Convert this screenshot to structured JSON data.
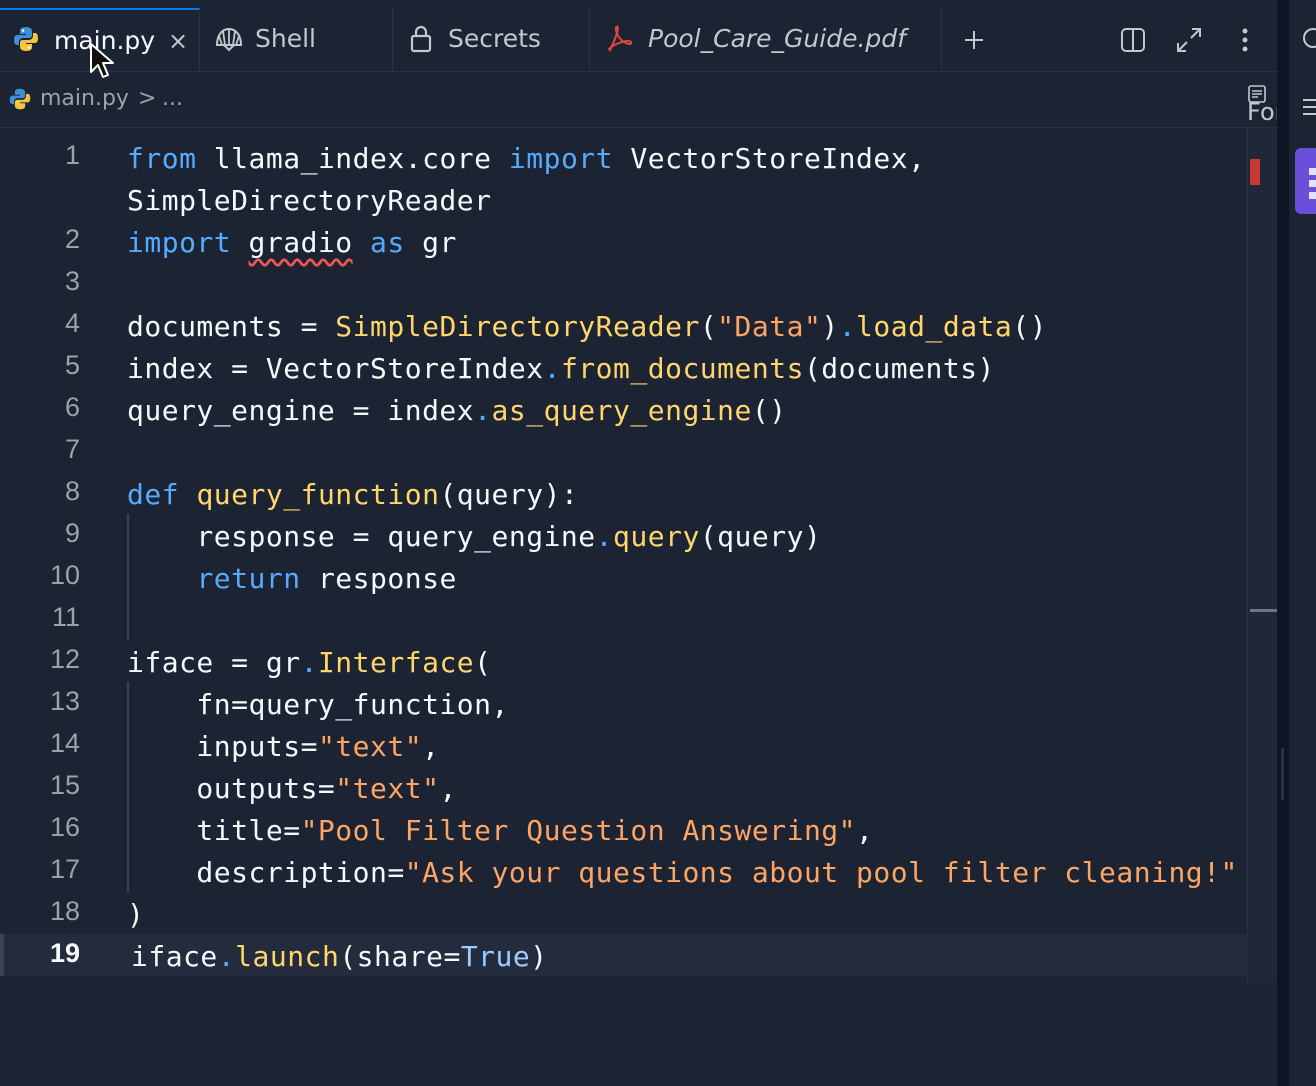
{
  "tabs": [
    {
      "label": "main.py",
      "icon": "python-icon",
      "active": true
    },
    {
      "label": "Shell",
      "icon": "shell-icon"
    },
    {
      "label": "Secrets",
      "icon": "lock-icon"
    },
    {
      "label": "Pool_Care_Guide.pdf",
      "icon": "pdf-icon"
    }
  ],
  "breadcrumb": {
    "file": "main.py",
    "separator": ">",
    "ellipsis": "..."
  },
  "toolbar": {
    "format_label": "Format"
  },
  "current_line": 19,
  "code_lines": [
    {
      "n": "1",
      "parts": [
        [
          "k",
          "from"
        ],
        [
          "t",
          " llama_index.core "
        ],
        [
          "k",
          "import"
        ],
        [
          "t",
          " VectorStoreIndex,"
        ]
      ]
    },
    {
      "n": "",
      "parts": [
        [
          "t",
          "SimpleDirectoryReader"
        ]
      ]
    },
    {
      "n": "2",
      "parts": [
        [
          "k",
          "import"
        ],
        [
          "t",
          " "
        ],
        [
          "w",
          "gradio"
        ],
        [
          "t",
          " "
        ],
        [
          "k",
          "as"
        ],
        [
          "t",
          " gr"
        ]
      ]
    },
    {
      "n": "3",
      "parts": []
    },
    {
      "n": "4",
      "parts": [
        [
          "t",
          "documents = "
        ],
        [
          "f",
          "SimpleDirectoryReader"
        ],
        [
          "t",
          "("
        ],
        [
          "s",
          "\"Data\""
        ],
        [
          "t",
          ")"
        ],
        [
          "k",
          "."
        ],
        [
          "f",
          "load_data"
        ],
        [
          "t",
          "()"
        ]
      ]
    },
    {
      "n": "5",
      "parts": [
        [
          "t",
          "index = VectorStoreIndex"
        ],
        [
          "k",
          "."
        ],
        [
          "f",
          "from_documents"
        ],
        [
          "t",
          "(documents)"
        ]
      ]
    },
    {
      "n": "6",
      "parts": [
        [
          "t",
          "query_engine = index"
        ],
        [
          "k",
          "."
        ],
        [
          "f",
          "as_query_engine"
        ],
        [
          "t",
          "()"
        ]
      ]
    },
    {
      "n": "7",
      "parts": []
    },
    {
      "n": "8",
      "parts": [
        [
          "k",
          "def"
        ],
        [
          "t",
          " "
        ],
        [
          "f",
          "query_function"
        ],
        [
          "t",
          "(query):"
        ]
      ]
    },
    {
      "n": "9",
      "parts": [
        [
          "t",
          "    response = query_engine"
        ],
        [
          "k",
          "."
        ],
        [
          "f",
          "query"
        ],
        [
          "t",
          "(query)"
        ]
      ]
    },
    {
      "n": "10",
      "parts": [
        [
          "t",
          "    "
        ],
        [
          "k",
          "return"
        ],
        [
          "t",
          " response"
        ]
      ]
    },
    {
      "n": "11",
      "parts": []
    },
    {
      "n": "12",
      "parts": [
        [
          "t",
          "iface = gr"
        ],
        [
          "k",
          "."
        ],
        [
          "f",
          "Interface"
        ],
        [
          "t",
          "("
        ]
      ]
    },
    {
      "n": "13",
      "parts": [
        [
          "t",
          "    fn=query_function,"
        ]
      ]
    },
    {
      "n": "14",
      "parts": [
        [
          "t",
          "    inputs="
        ],
        [
          "s",
          "\"text\""
        ],
        [
          "t",
          ","
        ]
      ]
    },
    {
      "n": "15",
      "parts": [
        [
          "t",
          "    outputs="
        ],
        [
          "s",
          "\"text\""
        ],
        [
          "t",
          ","
        ]
      ]
    },
    {
      "n": "16",
      "parts": [
        [
          "t",
          "    title="
        ],
        [
          "s",
          "\"Pool Filter Question Answering\""
        ],
        [
          "t",
          ","
        ]
      ]
    },
    {
      "n": "17",
      "parts": [
        [
          "t",
          "    description="
        ],
        [
          "s",
          "\"Ask your questions about pool filter cleaning!\""
        ]
      ]
    },
    {
      "n": "18",
      "parts": [
        [
          "t",
          ")"
        ]
      ]
    },
    {
      "n": "19",
      "parts": [
        [
          "t",
          "iface"
        ],
        [
          "k",
          "."
        ],
        [
          "f",
          "launch"
        ],
        [
          "t",
          "(share="
        ],
        [
          "c",
          "True"
        ],
        [
          "t",
          ")"
        ]
      ]
    }
  ],
  "colors": {
    "background": "#1c2333",
    "keyword": "#57abff",
    "function": "#ffd66b",
    "string": "#fda565",
    "constant": "#9ecbff",
    "accent": "#0079f2"
  }
}
